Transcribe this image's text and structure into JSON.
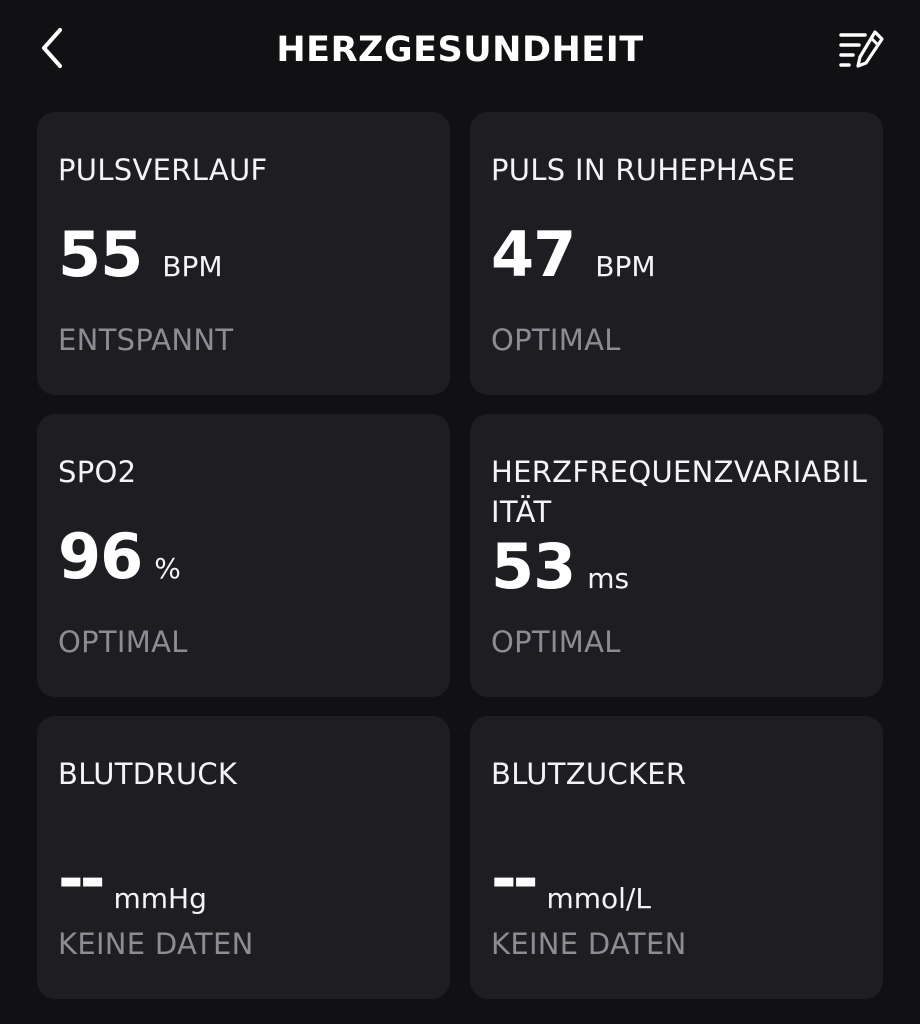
{
  "header": {
    "title": "HERZGESUNDHEIT",
    "back_icon": "chevron-left-icon",
    "edit_icon": "list-edit-icon"
  },
  "cards": [
    {
      "title": "PULSVERLAUF",
      "value": "55",
      "unit": "BPM",
      "status": "ENTSPANNT"
    },
    {
      "title": "PULS IN RUHEPHASE",
      "value": "47",
      "unit": "BPM",
      "status": "OPTIMAL"
    },
    {
      "title": "SPO2",
      "value": "96",
      "unit": "%",
      "status": "OPTIMAL"
    },
    {
      "title": "HERZFREQUENZVARIABILITÄT",
      "value": "53",
      "unit": "ms",
      "status": "OPTIMAL"
    },
    {
      "title": "BLUTDRUCK",
      "value": "--",
      "unit": "mmHg",
      "status": "KEINE DATEN"
    },
    {
      "title": "BLUTZUCKER",
      "value": "--",
      "unit": "mmol/L",
      "status": "KEINE DATEN"
    }
  ],
  "colors": {
    "background": "#111114",
    "card": "#1e1e22",
    "status_text": "#8c8c92"
  }
}
